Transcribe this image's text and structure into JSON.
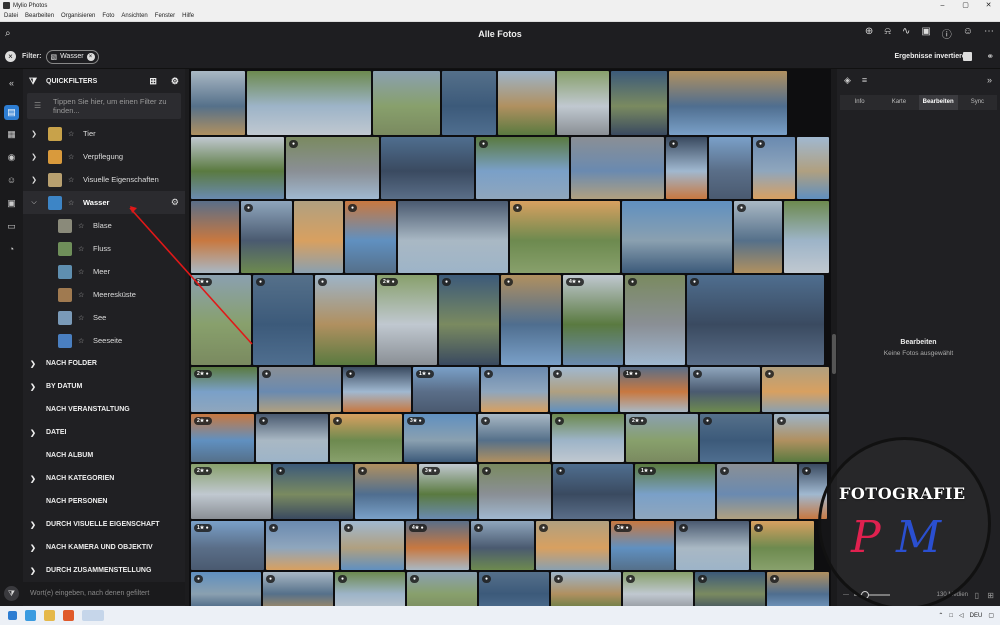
{
  "window": {
    "title": "Mylio Photos",
    "controls": [
      "–",
      "▢",
      "✕"
    ]
  },
  "menu": [
    "Datei",
    "Bearbeiten",
    "Organisieren",
    "Foto",
    "Ansichten",
    "Fenster",
    "Hilfe"
  ],
  "toolbar": {
    "title": "Alle Fotos"
  },
  "filterbar": {
    "label": "Filter:",
    "chip": "Wasser",
    "invert_label": "Ergebnisse invertieren"
  },
  "quickfilters": {
    "header": "QUICKFILTERS",
    "search_placeholder": "Tippen Sie hier, um einen Filter zu finden...",
    "items": [
      {
        "label": "Tier",
        "color": "#c8a24a"
      },
      {
        "label": "Verpflegung",
        "color": "#d99a3c"
      },
      {
        "label": "Visuelle Eigenschaften",
        "color": "#b8a070"
      },
      {
        "label": "Wasser",
        "color": "#3d85c6"
      }
    ],
    "sub_items": [
      {
        "label": "Blase",
        "color": "#8a8a7a"
      },
      {
        "label": "Fluss",
        "color": "#6f8f5a"
      },
      {
        "label": "Meer",
        "color": "#5f8fb0"
      },
      {
        "label": "Meeresküste",
        "color": "#a07a50"
      },
      {
        "label": "See",
        "color": "#7a9ab8"
      },
      {
        "label": "Seeseite",
        "color": "#4a7fc0"
      }
    ]
  },
  "sections": [
    {
      "label": "NACH FOLDER",
      "chevron": true
    },
    {
      "label": "BY DATUM",
      "chevron": true
    },
    {
      "label": "NACH VERANSTALTUNG",
      "chevron": false
    },
    {
      "label": "DATEI",
      "chevron": true
    },
    {
      "label": "NACH ALBUM",
      "chevron": false
    },
    {
      "label": "NACH KATEGORIEN",
      "chevron": true
    },
    {
      "label": "NACH PERSONEN",
      "chevron": false
    },
    {
      "label": "DURCH VISUELLE EIGENSCHAFT",
      "chevron": true
    },
    {
      "label": "NACH KAMERA UND OBJEKTIV",
      "chevron": true
    },
    {
      "label": "DURCH ZUSAMMENSTELLUNG",
      "chevron": true
    }
  ],
  "sidebar_bottom": {
    "hint": "Wort(e) eingeben, nach denen gefiltert"
  },
  "right_panel": {
    "tabs": [
      "Info",
      "Karte",
      "Bearbeiten",
      "Sync"
    ],
    "active_tab": "Bearbeiten",
    "message_title": "Bearbeiten",
    "message_sub": "Keine Fotos ausgewählt",
    "count": "130 Medien"
  },
  "watermark": {
    "text": "FOTOGRAFIE",
    "p": "P",
    "m": "M"
  },
  "taskbar": {
    "lang": "DEU"
  },
  "photo_badges": [
    "2★",
    "2★",
    "4★",
    "2★",
    "1★",
    "1★",
    "2★",
    "3★",
    "2★",
    "2★",
    "3★",
    "1★",
    "1★",
    "4★",
    "3★"
  ],
  "photo_colors": [
    "#a9b8c4",
    "#6d8a4f",
    "#8aa0b0",
    "#55708a",
    "#9db4c8",
    "#88a06c",
    "#3c5a7a",
    "#b09060",
    "#c0c8d0",
    "#7a8a60",
    "#4f6e8f",
    "#5a7a40",
    "#8a8f95",
    "#3a4a60",
    "#7aa0c8",
    "#6a8ab0",
    "#a0b8d0",
    "#5a6e88",
    "#8fa6bd",
    "#b0a080",
    "#c87840",
    "#4a5a70",
    "#d8a060",
    "#6090c0"
  ]
}
